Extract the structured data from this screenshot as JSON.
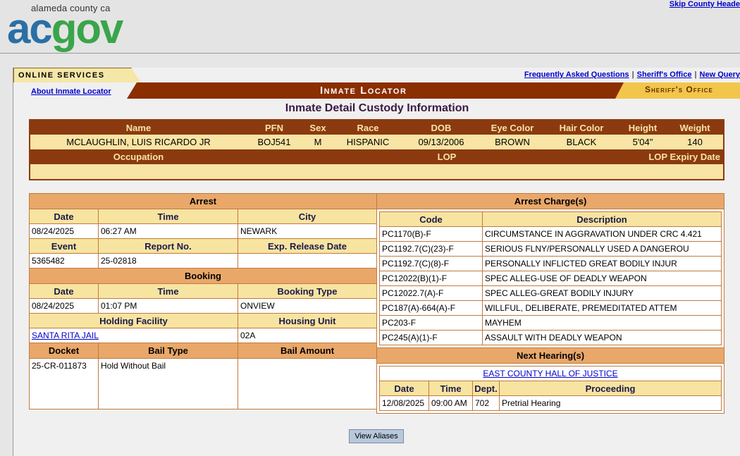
{
  "header": {
    "logo_small": "alameda county ca",
    "logo_ac": "ac",
    "logo_gov": "gov",
    "skip_link": "Skip County Heade"
  },
  "nav": {
    "online_services": "ONLINE SERVICES",
    "about_link": "About Inmate Locator",
    "faq_link": "Frequently Asked Questions",
    "sheriff_link": "Sheriff's Office",
    "new_query_link": "New Query",
    "banner_title": "Inmate Locator",
    "sheriff_tab": "Sheriff's Office"
  },
  "page_title": "Inmate Detail Custody Information",
  "person": {
    "headers": [
      "Name",
      "PFN",
      "Sex",
      "Race",
      "DOB",
      "Eye Color",
      "Hair Color",
      "Height",
      "Weight"
    ],
    "values": [
      "MCLAUGHLIN, LUIS RICARDO JR",
      "BOJ541",
      "M",
      "HISPANIC",
      "09/13/2006",
      "BROWN",
      "BLACK",
      "5'04\"",
      "140"
    ],
    "occupation_header": "Occupation",
    "lop_header": "LOP",
    "lop_expiry_header": "LOP Expiry Date"
  },
  "arrest": {
    "section": "Arrest",
    "date_label": "Date",
    "time_label": "Time",
    "city_label": "City",
    "date": "08/24/2025",
    "time": "06:27 AM",
    "city": "NEWARK",
    "event_label": "Event",
    "report_label": "Report No.",
    "exp_release_label": "Exp. Release Date",
    "event": "5365482",
    "report": "25-02818",
    "exp_release": ""
  },
  "booking": {
    "section": "Booking",
    "date_label": "Date",
    "time_label": "Time",
    "type_label": "Booking Type",
    "date": "08/24/2025",
    "time": "01:07 PM",
    "type": "ONVIEW",
    "facility_label": "Holding Facility",
    "unit_label": "Housing Unit",
    "facility": "SANTA RITA JAIL",
    "unit": "02A",
    "docket_label": "Docket",
    "bail_type_label": "Bail Type",
    "bail_amount_label": "Bail Amount",
    "docket": "25-CR-011873",
    "bail_type": "Hold Without Bail",
    "bail_amount": ""
  },
  "charges": {
    "section": "Arrest Charge(s)",
    "code_label": "Code",
    "desc_label": "Description",
    "rows": [
      {
        "code": "PC1170(B)-F",
        "desc": "CIRCUMSTANCE IN AGGRAVATION UNDER CRC 4.421"
      },
      {
        "code": "PC1192.7(C)(23)-F",
        "desc": "SERIOUS FLNY/PERSONALLY USED A DANGEROU"
      },
      {
        "code": "PC1192.7(C)(8)-F",
        "desc": "PERSONALLY INFLICTED GREAT BODILY INJUR"
      },
      {
        "code": "PC12022(B)(1)-F",
        "desc": "SPEC ALLEG-USE OF DEADLY WEAPON"
      },
      {
        "code": "PC12022.7(A)-F",
        "desc": "SPEC ALLEG-GREAT BODILY INJURY"
      },
      {
        "code": "PC187(A)-664(A)-F",
        "desc": "WILLFUL, DELIBERATE, PREMEDITATED ATTEM"
      },
      {
        "code": "PC203-F",
        "desc": "MAYHEM"
      },
      {
        "code": "PC245(A)(1)-F",
        "desc": "ASSAULT WITH DEADLY WEAPON"
      }
    ]
  },
  "hearing": {
    "section": "Next Hearing(s)",
    "location": "EAST COUNTY HALL OF JUSTICE",
    "date_label": "Date",
    "time_label": "Time",
    "dept_label": "Dept.",
    "proceeding_label": "Proceeding",
    "date": "12/08/2025",
    "time": "09:00 AM",
    "dept": "702",
    "proceeding": "Pretrial Hearing"
  },
  "view_aliases_label": "View Aliases",
  "colors": {
    "brown_header": "#8b3a10",
    "section_orange": "#e9a86a",
    "light_yellow": "#f8e4a4",
    "link_blue": "#0000cc"
  }
}
